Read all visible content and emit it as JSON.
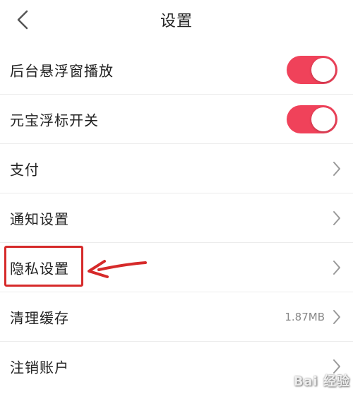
{
  "header": {
    "title": "设置",
    "back_icon": "chevron-left-icon"
  },
  "settings": {
    "floating_play": {
      "label": "后台悬浮窗播放",
      "toggle_on": true
    },
    "yuanbao_float": {
      "label": "元宝浮标开关",
      "toggle_on": true
    },
    "payment": {
      "label": "支付"
    },
    "notification": {
      "label": "通知设置"
    },
    "privacy": {
      "label": "隐私设置"
    },
    "clear_cache": {
      "label": "清理缓存",
      "value": "1.87MB"
    },
    "delete_account": {
      "label": "注销账户"
    }
  },
  "annotation": {
    "color": "#d62a2a",
    "target": "隐私设置"
  },
  "watermark": {
    "text": "Bai 经验"
  },
  "colors": {
    "toggle_on": "#f0425a",
    "divider": "#ececec",
    "text": "#222222",
    "secondary_text": "#888888"
  }
}
